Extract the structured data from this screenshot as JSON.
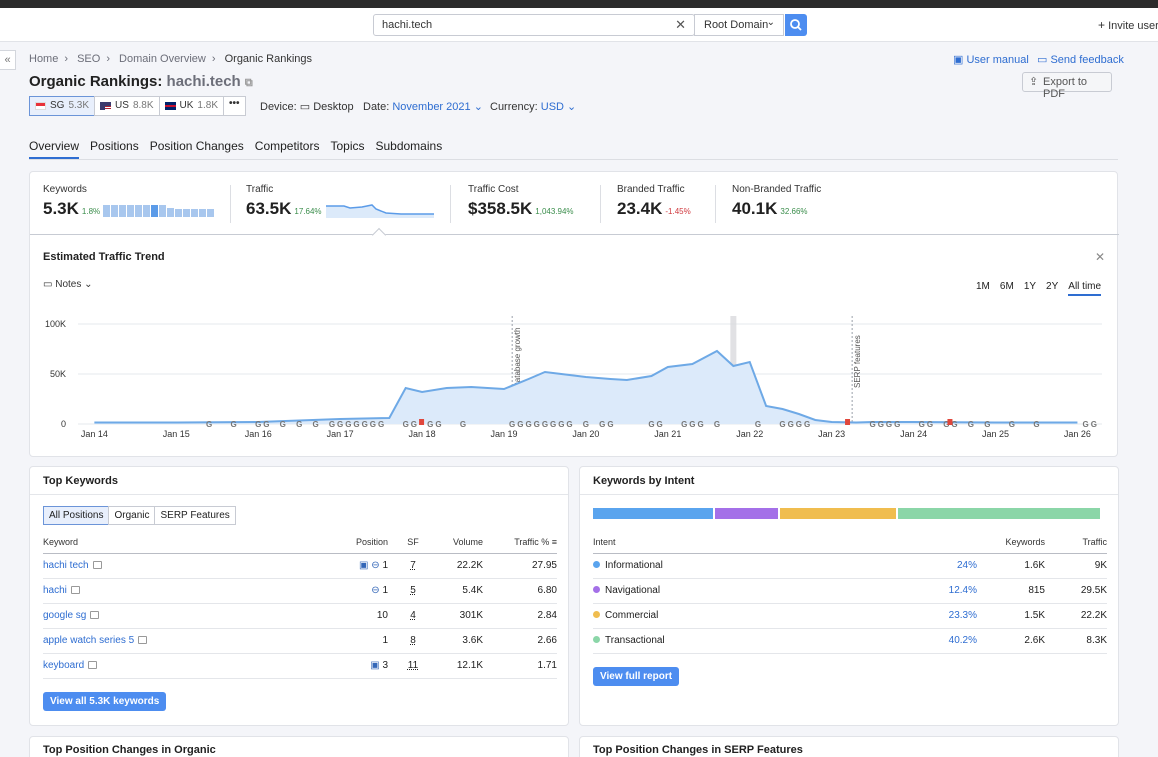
{
  "header": {
    "search_value": "hachi.tech",
    "domain_scope": "Root Domain",
    "invite": "Invite users"
  },
  "breadcrumb": [
    "Home",
    "SEO",
    "Domain Overview",
    "Organic Rankings"
  ],
  "page": {
    "title": "Organic Rankings:",
    "domain": "hachi.tech",
    "user_manual": "User manual",
    "send_feedback": "Send feedback",
    "export": "Export to PDF"
  },
  "databases": [
    {
      "code": "SG",
      "count": "5.3K",
      "active": true,
      "flag_colors": [
        "#e8323a",
        "#ffffff"
      ]
    },
    {
      "code": "US",
      "count": "8.8K",
      "active": false,
      "flag_colors": [
        "#3c3b6e",
        "#b22234"
      ]
    },
    {
      "code": "UK",
      "count": "1.8K",
      "active": false,
      "flag_colors": [
        "#012169",
        "#c8102e"
      ]
    }
  ],
  "filters": {
    "device_label": "Device:",
    "device_value": "Desktop",
    "date_label": "Date:",
    "date_value": "November 2021",
    "currency_label": "Currency:",
    "currency_value": "USD"
  },
  "tabs": [
    "Overview",
    "Positions",
    "Position Changes",
    "Competitors",
    "Topics",
    "Subdomains"
  ],
  "metrics": [
    {
      "label": "Keywords",
      "value": "5.3K",
      "delta": "1.8%",
      "delta_color": "#3a8d4b"
    },
    {
      "label": "Traffic",
      "value": "63.5K",
      "delta": "17.64%",
      "delta_color": "#3a8d4b"
    },
    {
      "label": "Traffic Cost",
      "value": "$358.5K",
      "delta": "1,043.94%",
      "delta_color": "#3a8d4b"
    },
    {
      "label": "Branded Traffic",
      "value": "23.4K",
      "delta": "-1.45%",
      "delta_color": "#d0393e"
    },
    {
      "label": "Non-Branded Traffic",
      "value": "40.1K",
      "delta": "32.66%",
      "delta_color": "#3a8d4b"
    }
  ],
  "trend": {
    "title": "Estimated Traffic Trend",
    "notes": "Notes",
    "ranges": [
      "1M",
      "6M",
      "1Y",
      "2Y",
      "All time"
    ],
    "active_range": "All time",
    "annotations": [
      "Database growth",
      "SERP features"
    ]
  },
  "chart_data": {
    "type": "area",
    "y_ticks": [
      "100K",
      "50K",
      "0"
    ],
    "ylim": [
      0,
      100000
    ],
    "x_ticks": [
      "Jan 14",
      "Jan 15",
      "Jan 16",
      "Jan 17",
      "Jan 18",
      "Jan 19",
      "Jan 20",
      "Jan 21",
      "Jan 22",
      "Jan 23",
      "Jan 24",
      "Jan 25",
      "Jan 26"
    ],
    "x": [
      14.0,
      15.0,
      16.0,
      17.0,
      17.6,
      17.8,
      18.0,
      18.3,
      18.6,
      19.0,
      19.3,
      19.5,
      19.7,
      20.0,
      20.3,
      20.5,
      20.8,
      21.0,
      21.3,
      21.6,
      21.8,
      22.0,
      22.2,
      22.4,
      22.6,
      22.8,
      23.0,
      23.3,
      23.5,
      24.0,
      25.0,
      26.0
    ],
    "y": [
      1500,
      1500,
      2000,
      5000,
      6000,
      36000,
      32000,
      36000,
      37000,
      35000,
      45000,
      52000,
      50000,
      47000,
      45000,
      44000,
      48000,
      57000,
      60000,
      73000,
      58000,
      62000,
      18000,
      15000,
      10000,
      4000,
      2000,
      1500,
      2000,
      2000,
      1500,
      1500
    ],
    "series_color": "#6ea9e6",
    "fill_color": "#dceafa"
  },
  "top_keywords": {
    "title": "Top Keywords",
    "filters": [
      "All Positions",
      "Organic",
      "SERP Features"
    ],
    "columns": [
      "Keyword",
      "Position",
      "SF",
      "Volume",
      "Traffic %"
    ],
    "rows": [
      {
        "keyword": "hachi tech",
        "position": "1",
        "sf": "7",
        "volume": "22.2K",
        "traffic": "27.95"
      },
      {
        "keyword": "hachi",
        "position": "1",
        "sf": "5",
        "volume": "5.4K",
        "traffic": "6.80"
      },
      {
        "keyword": "google sg",
        "position": "10",
        "sf": "4",
        "volume": "301K",
        "traffic": "2.84"
      },
      {
        "keyword": "apple watch series 5",
        "position": "1",
        "sf": "8",
        "volume": "3.6K",
        "traffic": "2.66"
      },
      {
        "keyword": "keyboard",
        "position": "3",
        "sf": "11",
        "volume": "12.1K",
        "traffic": "1.71"
      }
    ],
    "view_all": "View all 5.3K keywords"
  },
  "intent": {
    "title": "Keywords by Intent",
    "columns": [
      "Intent",
      "Keywords",
      "Traffic"
    ],
    "rows": [
      {
        "name": "Informational",
        "pct": "24%",
        "share": 0.24,
        "keywords": "1.6K",
        "traffic": "9K",
        "color": "#5aa4ee"
      },
      {
        "name": "Navigational",
        "pct": "12.4%",
        "share": 0.124,
        "keywords": "815",
        "traffic": "29.5K",
        "color": "#a470e8"
      },
      {
        "name": "Commercial",
        "pct": "23.3%",
        "share": 0.233,
        "keywords": "1.5K",
        "traffic": "22.2K",
        "color": "#f0bd4f"
      },
      {
        "name": "Transactional",
        "pct": "40.2%",
        "share": 0.402,
        "keywords": "2.6K",
        "traffic": "8.3K",
        "color": "#8bd6a8"
      }
    ],
    "view_full": "View full report"
  },
  "bottom": {
    "left_title": "Top Position Changes in Organic",
    "right_title": "Top Position Changes in SERP Features"
  }
}
